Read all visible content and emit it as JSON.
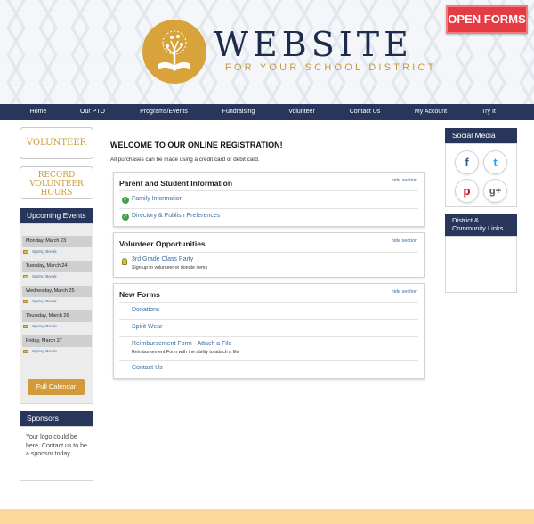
{
  "header": {
    "logo_title": "WEBSITE",
    "logo_subtitle": "FOR YOUR SCHOOL DISTRICT",
    "open_forms": "OPEN FORMS"
  },
  "nav": {
    "items": [
      {
        "label": "Home"
      },
      {
        "label": "Our PTO"
      },
      {
        "label": "Programs/Events"
      },
      {
        "label": "Fundraising"
      },
      {
        "label": "Volunteer"
      },
      {
        "label": "Contact Us"
      },
      {
        "label": "My Account"
      },
      {
        "label": "Try It"
      }
    ]
  },
  "left": {
    "volunteer_label": "VOLUNTEER",
    "record_line1": "RECORD",
    "record_line2": "VOLUNTEER",
    "record_line3": "HOURS",
    "upcoming_title": "Upcoming Events",
    "events": [
      {
        "date": "Monday, March 23",
        "item": "Spring Break"
      },
      {
        "date": "Tuesday, March 24",
        "item": "Spring Break"
      },
      {
        "date": "Wednesday, March 25",
        "item": "Spring Break"
      },
      {
        "date": "Thursday, March 26",
        "item": "Spring Break"
      },
      {
        "date": "Friday, March 27",
        "item": "Spring Break"
      }
    ],
    "full_calendar": "Full Calendar",
    "sponsors_title": "Sponsors",
    "sponsors_text": "Your logo could be here. Contact us to be a sponsor today."
  },
  "main": {
    "welcome": "WELCOME TO OUR ONLINE REGISTRATION!",
    "purchases_note": "All purchases can be made using a credit card or debit card.",
    "hide_label": "hide section",
    "parent_title": "Parent and Student Information",
    "parent_items": [
      "Family Information",
      "Directory & Publish Preferences"
    ],
    "volunteer_title": "Volunteer Opportunities",
    "volunteer_item": "3rd Grade Class Party",
    "volunteer_item_sub": "Sign up to volunteer or donate items",
    "forms_title": "New Forms",
    "forms_items": [
      "Donations",
      "Spirit Wear",
      "Reimbursement Form - Attach a File",
      "Contact Us"
    ],
    "forms_item3_sub": "Reimbursement Form with the ability to attach a file"
  },
  "right": {
    "social_title": "Social Media",
    "social_icons": [
      "facebook-icon",
      "twitter-icon",
      "pinterest-icon",
      "google-plus-icon"
    ],
    "social_glyphs": {
      "facebook": "f",
      "twitter": "t",
      "pinterest": "p",
      "google_plus": "g+"
    },
    "district_line1": "District &",
    "district_line2": "Community Links"
  },
  "colors": {
    "navy": "#27365a",
    "gold": "#d39a3a",
    "red": "#e53c43",
    "link": "#3a6ea5",
    "footer": "#fcd99a"
  }
}
